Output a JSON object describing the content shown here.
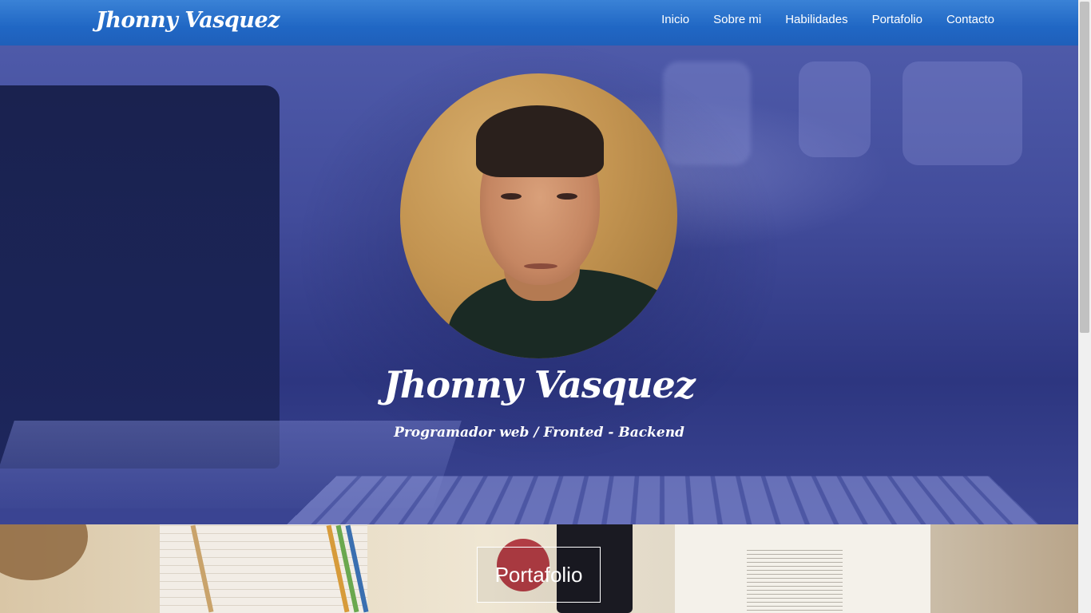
{
  "nav": {
    "brand": "Jhonny Vasquez",
    "items": [
      {
        "label": "Inicio"
      },
      {
        "label": "Sobre mi"
      },
      {
        "label": "Habilidades"
      },
      {
        "label": "Portafolio"
      },
      {
        "label": "Contacto"
      }
    ]
  },
  "hero": {
    "name": "Jhonny Vasquez",
    "subtitle": "Programador web / Fronted - Backend"
  },
  "portfolio": {
    "button_label": "Portafolio"
  },
  "colors": {
    "navbar": "#2067c4",
    "hero_overlay": "#424c9b",
    "text": "#ffffff"
  }
}
